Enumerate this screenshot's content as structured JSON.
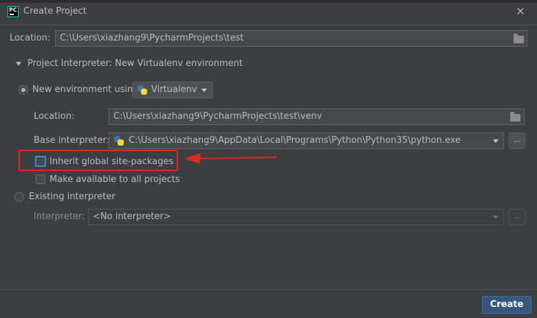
{
  "window": {
    "title": "Create Project"
  },
  "location": {
    "label": "Location:",
    "value": "C:\\Users\\xiazhang9\\PycharmProjects\\test"
  },
  "interpreter_section": {
    "title": "Project Interpreter: New Virtualenv environment"
  },
  "new_env": {
    "label": "New environment using",
    "tool": "Virtualenv",
    "location_label": "Location:",
    "location_value": "C:\\Users\\xiazhang9\\PycharmProjects\\test\\venv",
    "base_label": "Base interpreter:",
    "base_value": "C:\\Users\\xiazhang9\\AppData\\Local\\Programs\\Python\\Python35\\python.exe",
    "browse": "...",
    "inherit_label": "Inherit global site-packages",
    "make_available_label": "Make available to all projects"
  },
  "existing": {
    "label": "Existing interpreter",
    "interpreter_label": "Interpreter:",
    "interpreter_value": "<No interpreter>",
    "browse": "..."
  },
  "footer": {
    "create_label": "Create"
  },
  "colors": {
    "background": "#3c3f41",
    "accent": "#365880",
    "annotation": "#e8261c",
    "focus": "#4a88c7"
  }
}
